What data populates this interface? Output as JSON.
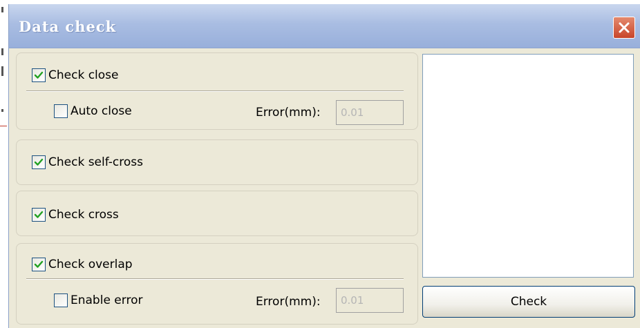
{
  "window": {
    "title": "Data check"
  },
  "icons": {
    "close": "close-icon",
    "check": "checkmark-icon"
  },
  "colors": {
    "title_bar": "#a9bde2",
    "close_button": "#c8452a",
    "panel": "#ece9d8",
    "check": "#21a121"
  },
  "groups": {
    "close": {
      "label": "Check close",
      "checked": true,
      "auto_close": {
        "label": "Auto close",
        "checked": false
      },
      "error_label": "Error(mm):",
      "error_value": "0.01"
    },
    "self_cross": {
      "label": "Check self-cross",
      "checked": true
    },
    "cross": {
      "label": "Check cross",
      "checked": true
    },
    "overlap": {
      "label": "Check overlap",
      "checked": true,
      "enable_error": {
        "label": "Enable error",
        "checked": false
      },
      "error_label": "Error(mm):",
      "error_value": "0.01"
    }
  },
  "buttons": {
    "check_label": "Check"
  }
}
